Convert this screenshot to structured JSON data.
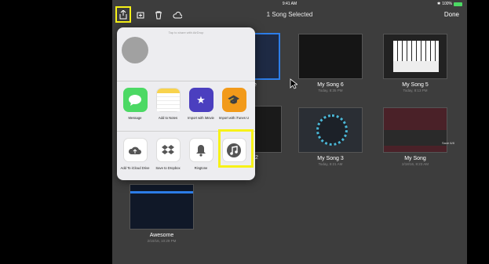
{
  "status": {
    "time": "9:41 AM",
    "battery": "100%"
  },
  "nav": {
    "title": "1 Song Selected",
    "done_label": "Done"
  },
  "popover": {
    "airdrop_hint": "Tap to share with AirDrop",
    "share_items": [
      {
        "label": "Message",
        "color": "#4cd964"
      },
      {
        "label": "Add to Notes",
        "color": "#ffffff"
      },
      {
        "label": "Import with iMovie",
        "color": "#4b3fbf"
      },
      {
        "label": "Import with iTunes U",
        "color": "#f29a1a"
      }
    ],
    "action_items": [
      {
        "label": "Add To iCloud Drive"
      },
      {
        "label": "Save to Dropbox"
      },
      {
        "label": "Ringtone"
      },
      {
        "label": ""
      }
    ]
  },
  "songs": [
    {
      "name": "My Song 6",
      "date": "Today, 8:35 PM"
    },
    {
      "name": "My Song 5",
      "date": "Today, 8:13 PM"
    },
    {
      "name": "My Song 3",
      "date": "Today, 8:21 AM"
    },
    {
      "name": "My Song",
      "date": "2/18/16, 8:23 AM"
    },
    {
      "name": "Awesome",
      "date": "2/10/16, 10:29 PM"
    }
  ],
  "partial_labels": {
    "a": "e",
    "b": "2"
  },
  "overlay_text": "Save 6/8"
}
